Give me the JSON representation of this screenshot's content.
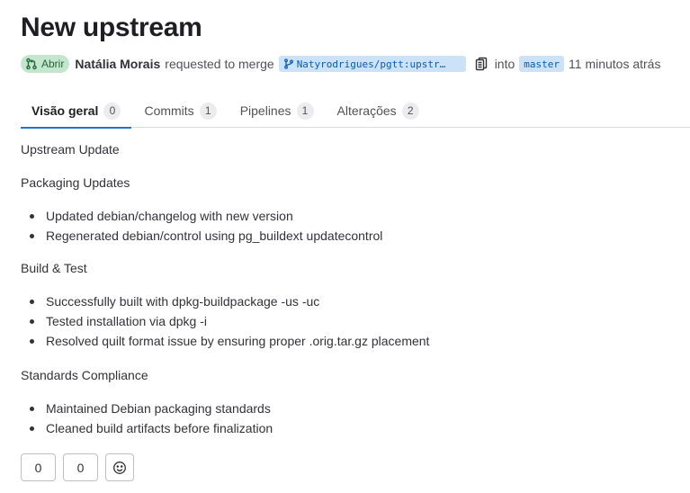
{
  "title": "New upstream",
  "meta": {
    "status": "Abrir",
    "author": "Natália Morais",
    "action_text": "requested to merge",
    "source_branch": "Natyrodrigues/pgtt:upstr…",
    "into_text": "into",
    "target_branch": "master",
    "time_ago": "11 minutos atrás"
  },
  "tabs": [
    {
      "label": "Visão geral",
      "count": "0"
    },
    {
      "label": "Commits",
      "count": "1"
    },
    {
      "label": "Pipelines",
      "count": "1"
    },
    {
      "label": "Alterações",
      "count": "2"
    }
  ],
  "description": {
    "p1": "Upstream Update",
    "h_packaging": "Packaging Updates",
    "packaging": [
      "Updated debian/changelog with new version",
      "Regenerated debian/control using pg_buildext updatecontrol"
    ],
    "h_build": "Build & Test",
    "build": [
      "Successfully built with dpkg-buildpackage -us -uc",
      "Tested installation via dpkg -i",
      "Resolved quilt format issue by ensuring proper .orig.tar.gz placement"
    ],
    "h_standards": "Standards Compliance",
    "standards": [
      "Maintained Debian packaging standards",
      "Cleaned build artifacts before finalization"
    ]
  },
  "reactions": {
    "thumbs_up": "0",
    "thumbs_down": "0"
  },
  "icons": {
    "status": "merge-request-icon",
    "branch": "branch-icon",
    "copy": "copy-icon",
    "emoji": "smiley-icon"
  },
  "colors": {
    "status_bg": "#c3e6cd",
    "status_fg": "#24663b",
    "branch_bg": "#cbe2f9",
    "branch_fg": "#0b5cad",
    "tab_active": "#1f75cb"
  }
}
